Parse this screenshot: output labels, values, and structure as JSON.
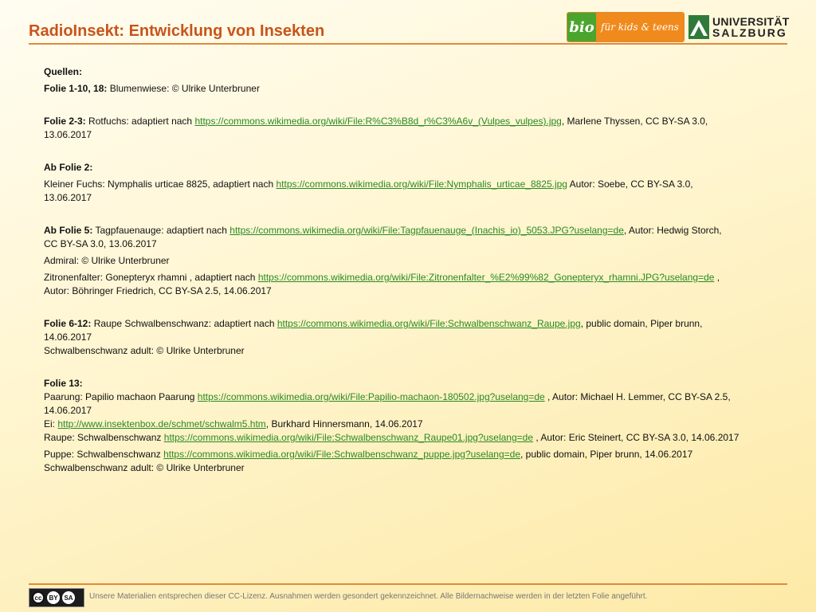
{
  "header": {
    "title": "RadioInsekt: Entwicklung von Insekten",
    "logo_bio": "bio",
    "logo_kids": "für kids & teens",
    "logo_uni_line1": "UNIVERSITÄT",
    "logo_uni_line2": "SALZBURG"
  },
  "sources": {
    "heading": "Quellen:",
    "f1_label": "Folie 1-10, 18:",
    "f1_text": " Blumenwiese: © Ulrike Unterbruner",
    "f23_label": "Folie 2-3:",
    "f23_pre": " Rotfuchs:  adaptiert nach ",
    "f23_link": "https://commons.wikimedia.org/wiki/File:R%C3%B8d_r%C3%A6v_(Vulpes_vulpes).jpg",
    "f23_post": ", Marlene Thyssen, CC BY-SA 3.0,",
    "f23_date": "13.06.2017",
    "ab2_label": "Ab Folie 2:",
    "ab2_pre": "Kleiner Fuchs: Nymphalis urticae 8825, adaptiert nach ",
    "ab2_link": "https://commons.wikimedia.org/wiki/File:Nymphalis_urticae_8825.jpg",
    "ab2_post": "  Autor: Soebe, CC BY-SA 3.0,",
    "ab2_date": "13.06.2017",
    "ab5_label": "Ab Folie 5:",
    "ab5_pre": " Tagpfauenauge:  adaptiert nach ",
    "ab5_link": "https://commons.wikimedia.org/wiki/File:Tagpfauenauge_(Inachis_io)_5053.JPG?uselang=de",
    "ab5_post": ", Autor: Hedwig Storch,",
    "ab5_line2": "CC BY-SA 3.0, 13.06.2017",
    "admiral": "Admiral:  © Ulrike Unterbruner",
    "zitron_pre": "Zitronenfalter: Gonepteryx rhamni , adaptiert nach ",
    "zitron_link": "https://commons.wikimedia.org/wiki/File:Zitronenfalter_%E2%99%82_Gonepteryx_rhamni.JPG?uselang=de",
    "zitron_post": " ,",
    "zitron_line2": "Autor: Böhringer Friedrich, CC BY-SA 2.5, 14.06.2017",
    "f612_label": "Folie 6-12:",
    "f612_pre": " Raupe Schwalbenschwanz: adaptiert nach ",
    "f612_link": "https://commons.wikimedia.org/wiki/File:Schwalbenschwanz_Raupe.jpg",
    "f612_post": ", public domain, Piper brunn,",
    "f612_date": "14.06.2017",
    "f612_adult": "Schwalbenschwanz adult: © Ulrike Unterbruner",
    "f13_label": "Folie 13:",
    "paarung_pre": "Paarung: Papilio machaon Paarung ",
    "paarung_link": "https://commons.wikimedia.org/wiki/File:Papilio-machaon-180502.jpg?uselang=de",
    "paarung_post": " , Autor: Michael H. Lemmer, CC BY-SA 2.5,",
    "paarung_date": "14.06.2017",
    "ei_pre": "Ei: ",
    "ei_link": "http://www.insektenbox.de/schmet/schwalm5.htm",
    "ei_post": ", Burkhard Hinnersmann, 14.06.2017",
    "raupe_pre": "Raupe: Schwalbenschwanz ",
    "raupe_link": "https://commons.wikimedia.org/wiki/File:Schwalbenschwanz_Raupe01.jpg?uselang=de",
    "raupe_post": " , Autor: Eric Steinert, CC BY-SA 3.0, 14.06.2017",
    "puppe_pre": "Puppe: Schwalbenschwanz ",
    "puppe_link": "https://commons.wikimedia.org/wiki/File:Schwalbenschwanz_puppe.jpg?uselang=de",
    "puppe_post": ", public domain, Piper brunn, 14.06.2017",
    "f13_adult": "Schwalbenschwanz adult: © Ulrike Unterbruner"
  },
  "footer": {
    "cc_icon": "cc-by-sa-badge",
    "cc_by": "BY",
    "cc_sa": "SA",
    "text": "Unsere Materialien entsprechen dieser CC-Lizenz. Ausnahmen werden gesondert gekennzeichnet. Alle Bildernachweise werden in der letzten Folie angeführt."
  },
  "colors": {
    "title": "#c8541a",
    "rule": "#e08a3c",
    "link": "#2a8a20",
    "bio_green": "#4aa52e",
    "bio_orange": "#f08a1c"
  }
}
